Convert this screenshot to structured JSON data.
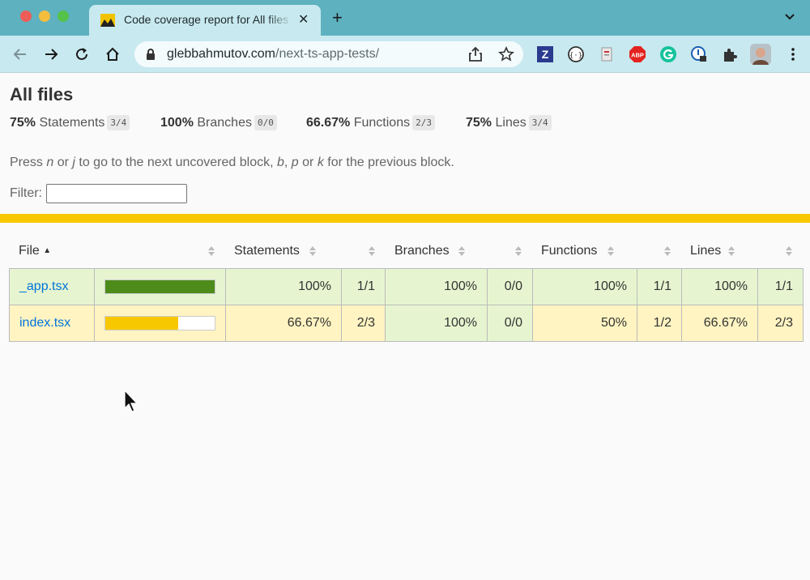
{
  "browser": {
    "tab_title": "Code coverage report for All files",
    "url_host": "glebbahmutov.com",
    "url_path": "/next-ts-app-tests/",
    "extensions": [
      "zotero-icon",
      "json-viewer-icon",
      "clipboard-icon",
      "adblock-plus-icon",
      "grammarly-icon",
      "password-manager-icon",
      "puzzle-icon",
      "avatar"
    ],
    "abp_label": "ABP",
    "zotero_label": "Z"
  },
  "report": {
    "title": "All files",
    "summary": [
      {
        "pct": "75%",
        "label": "Statements",
        "fraction": "3/4"
      },
      {
        "pct": "100%",
        "label": "Branches",
        "fraction": "0/0"
      },
      {
        "pct": "66.67%",
        "label": "Functions",
        "fraction": "2/3"
      },
      {
        "pct": "75%",
        "label": "Lines",
        "fraction": "3/4"
      }
    ],
    "hint": {
      "t1": "Press ",
      "k1": "n",
      "t2": " or ",
      "k2": "j",
      "t3": " to go to the next uncovered block, ",
      "k3": "b",
      "t4": ", ",
      "k4": "p",
      "t5": " or ",
      "k5": "k",
      "t6": " for the previous block."
    },
    "filter_label": "Filter:",
    "filter_value": "",
    "headers": {
      "file": "File",
      "statements": "Statements",
      "branches": "Branches",
      "functions": "Functions",
      "lines": "Lines"
    },
    "rows": [
      {
        "file": "_app.tsx",
        "coverage": 1.0,
        "statements_pct": "100%",
        "statements_abs": "1/1",
        "branches_pct": "100%",
        "branches_abs": "0/0",
        "functions_pct": "100%",
        "functions_abs": "1/1",
        "lines_pct": "100%",
        "lines_abs": "1/1"
      },
      {
        "file": "index.tsx",
        "coverage": 0.6667,
        "statements_pct": "66.67%",
        "statements_abs": "2/3",
        "branches_pct": "100%",
        "branches_abs": "0/0",
        "functions_pct": "50%",
        "functions_abs": "1/2",
        "lines_pct": "66.67%",
        "lines_abs": "2/3"
      }
    ],
    "colors": {
      "high_bar": "#4d8c1b",
      "medium_bar": "#f7c800",
      "status_bar": "#f7c800",
      "link": "#0074d9"
    }
  }
}
